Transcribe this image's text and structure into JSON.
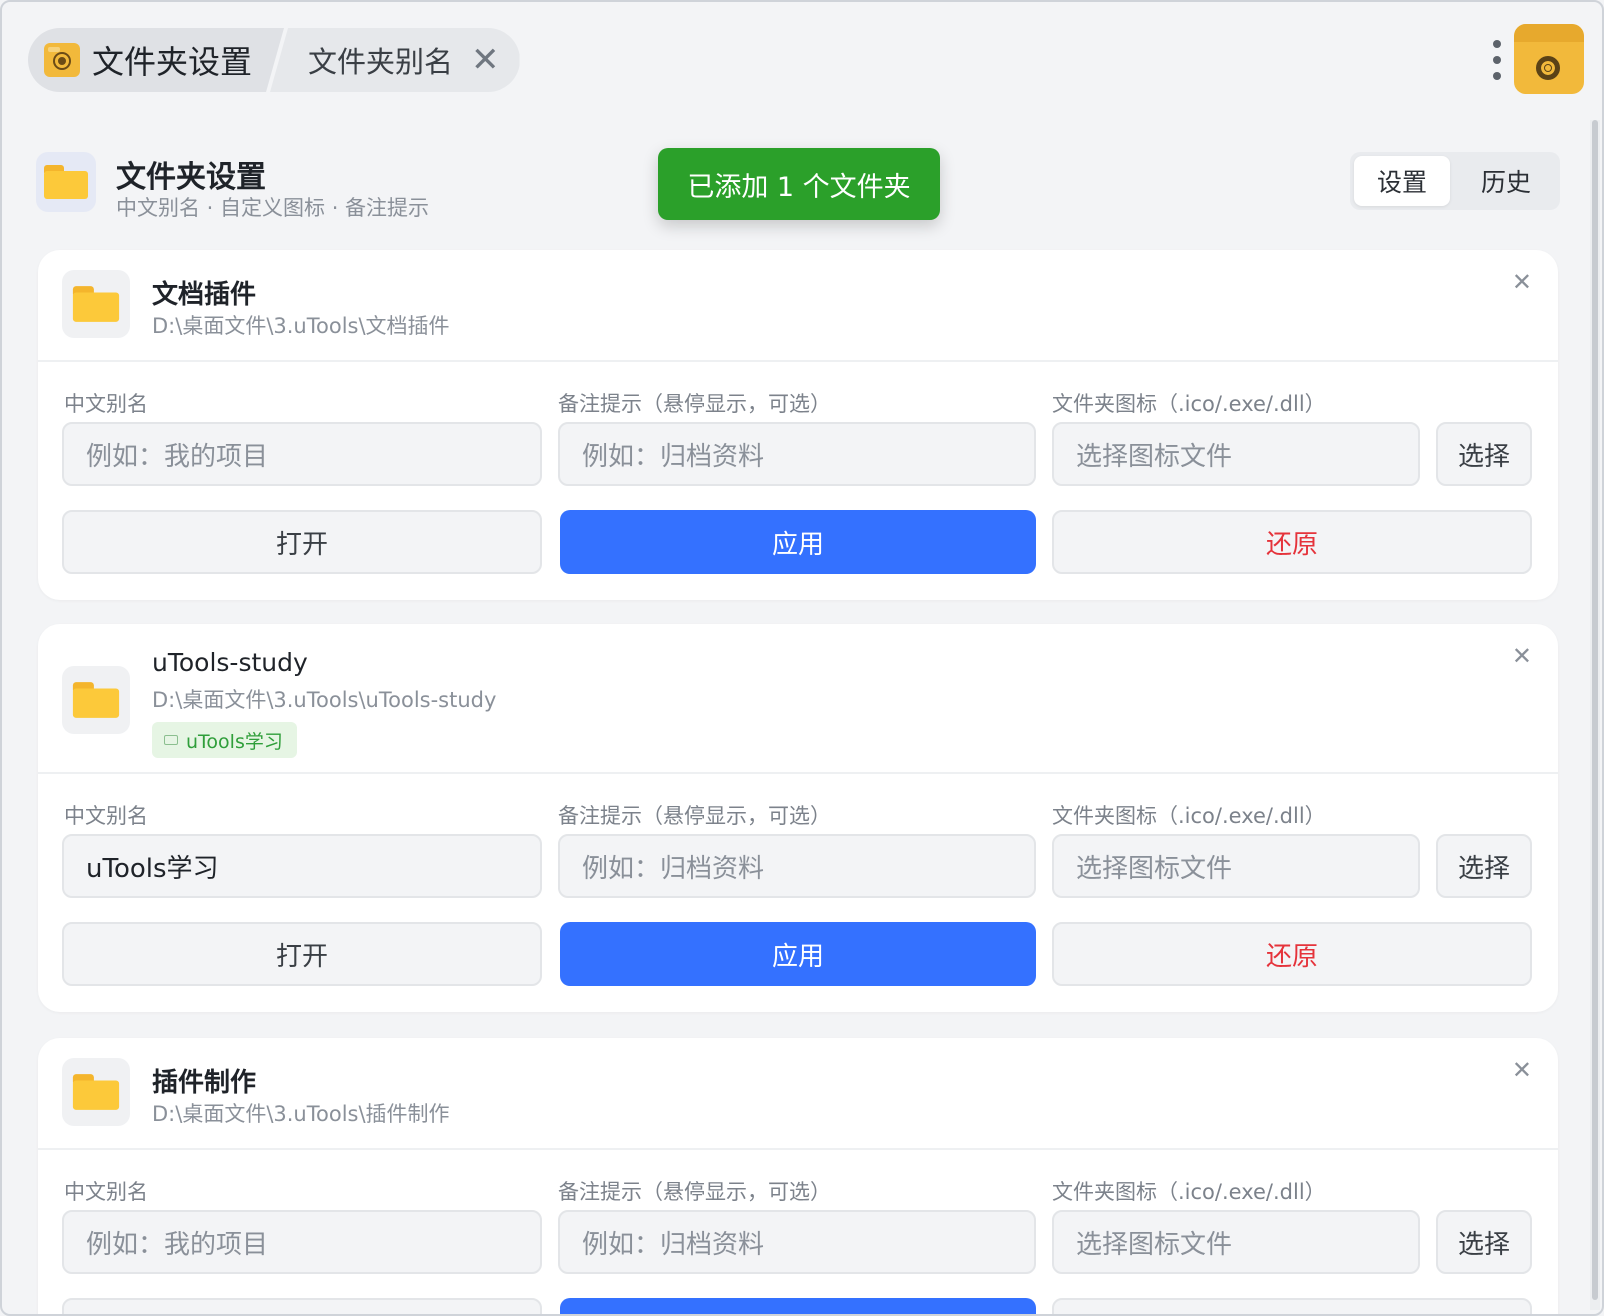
{
  "tabs": {
    "main": "文件夹设置",
    "sub": "文件夹别名"
  },
  "header": {
    "title": "文件夹设置",
    "subtitle": "中文别名 · 自定义图标 · 备注提示",
    "segments": [
      "设置",
      "历史"
    ]
  },
  "toast": "已添加 1 个文件夹",
  "labels": {
    "alias": "中文别名",
    "note": "备注提示（悬停显示，可选）",
    "icon": "文件夹图标（.ico/.exe/.dll）"
  },
  "placeholders": {
    "alias": "例如：我的项目",
    "note": "例如：归档资料",
    "icon": "选择图标文件"
  },
  "buttons": {
    "choose": "选择",
    "open": "打开",
    "apply": "应用",
    "restore": "还原"
  },
  "cards": [
    {
      "title": "文档插件",
      "path": "D:\\桌面文件\\3.uTools\\文档插件",
      "alias": "",
      "tag": ""
    },
    {
      "title": "uTools-study",
      "path": "D:\\桌面文件\\3.uTools\\uTools-study",
      "alias": "uTools学习",
      "tag": "uTools学习"
    },
    {
      "title": "插件制作",
      "path": "D:\\桌面文件\\3.uTools\\插件制作",
      "alias": "",
      "tag": ""
    }
  ],
  "colors": {
    "primary": "#3471ff",
    "success": "#2ba02a",
    "danger": "#e5333b",
    "folder": "#fcc93a"
  }
}
